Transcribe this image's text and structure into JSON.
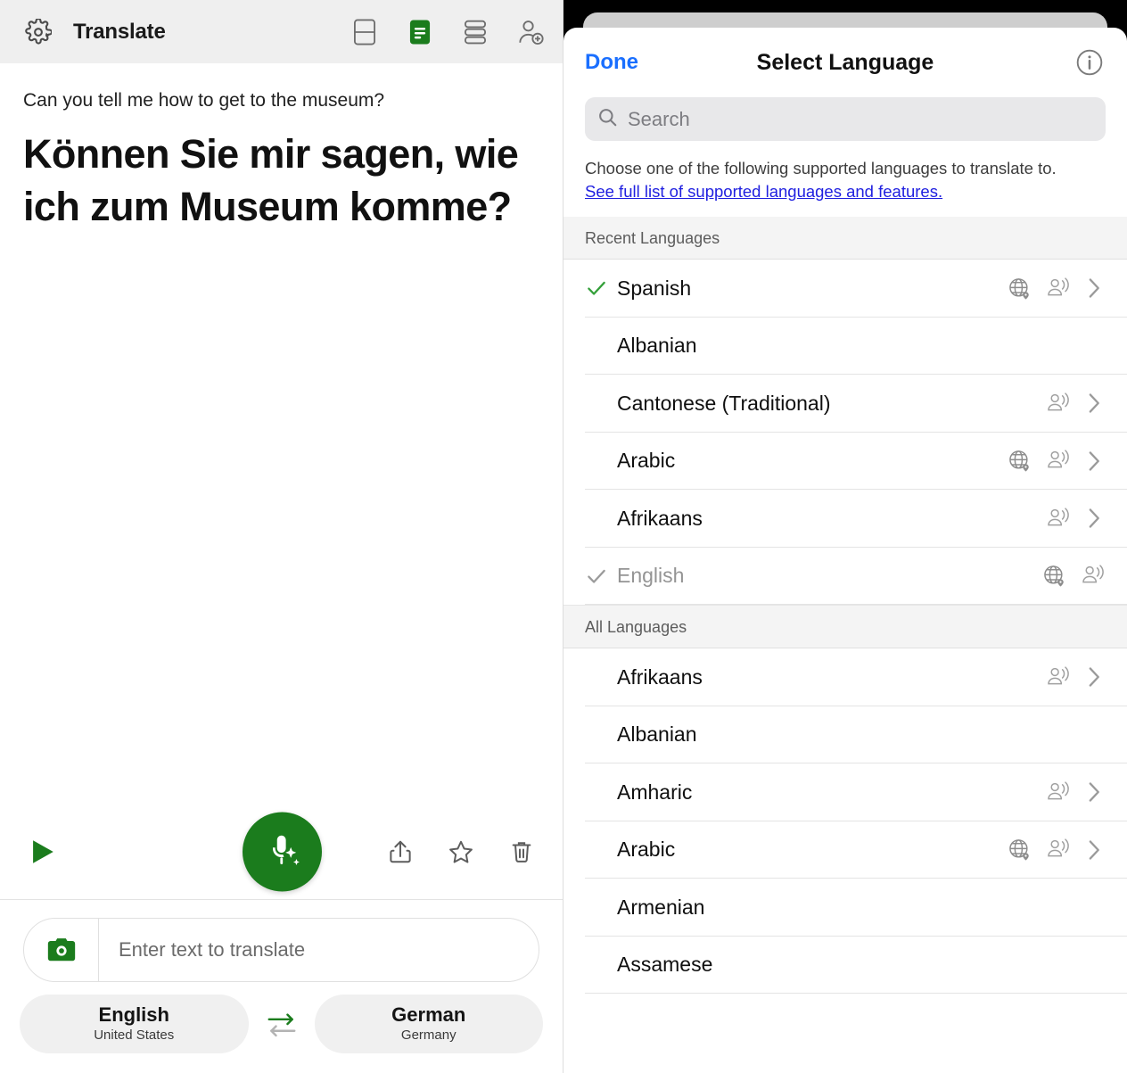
{
  "left": {
    "app_bar": {
      "title": "Translate",
      "gear_icon": "gear-icon",
      "icons": [
        {
          "name": "split-view-icon",
          "active": false
        },
        {
          "name": "document-translate-icon",
          "active": true
        },
        {
          "name": "stacked-list-icon",
          "active": false
        },
        {
          "name": "add-person-icon",
          "active": false
        }
      ]
    },
    "translation": {
      "source_text": "Can you tell me how to get to the museum?",
      "target_text": "Können Sie mir sagen, wie ich zum Museum komme?"
    },
    "actions": {
      "play_icon": "play-icon",
      "mic_icon": "mic-sparkle-icon",
      "share_icon": "share-icon",
      "star_icon": "star-icon",
      "delete_icon": "trash-icon"
    },
    "input": {
      "camera_icon": "camera-icon",
      "placeholder": "Enter text to translate"
    },
    "languages": {
      "source": {
        "name": "English",
        "region": "United States"
      },
      "target": {
        "name": "German",
        "region": "Germany"
      },
      "swap_icon": "swap-arrows-icon"
    }
  },
  "right": {
    "header": {
      "done_label": "Done",
      "title": "Select Language",
      "info_icon": "info-circle-icon"
    },
    "search": {
      "placeholder": "Search",
      "icon": "search-icon"
    },
    "note": {
      "text": "Choose one of the following supported languages to translate to.",
      "link": "See full list of supported languages and features."
    },
    "sections": [
      {
        "header": "Recent Languages",
        "items": [
          {
            "name": "Spanish",
            "checked": true,
            "disabled": false,
            "globe": true,
            "speak": true,
            "chevron": true
          },
          {
            "name": "Albanian",
            "checked": false,
            "disabled": false,
            "globe": false,
            "speak": false,
            "chevron": false
          },
          {
            "name": "Cantonese (Traditional)",
            "checked": false,
            "disabled": false,
            "globe": false,
            "speak": true,
            "chevron": true
          },
          {
            "name": "Arabic",
            "checked": false,
            "disabled": false,
            "globe": true,
            "speak": true,
            "chevron": true
          },
          {
            "name": "Afrikaans",
            "checked": false,
            "disabled": false,
            "globe": false,
            "speak": true,
            "chevron": true
          },
          {
            "name": "English",
            "checked": true,
            "disabled": true,
            "globe": true,
            "speak": true,
            "chevron": false
          }
        ]
      },
      {
        "header": "All Languages",
        "items": [
          {
            "name": "Afrikaans",
            "checked": false,
            "disabled": false,
            "globe": false,
            "speak": true,
            "chevron": true
          },
          {
            "name": "Albanian",
            "checked": false,
            "disabled": false,
            "globe": false,
            "speak": false,
            "chevron": false
          },
          {
            "name": "Amharic",
            "checked": false,
            "disabled": false,
            "globe": false,
            "speak": true,
            "chevron": true
          },
          {
            "name": "Arabic",
            "checked": false,
            "disabled": false,
            "globe": true,
            "speak": true,
            "chevron": true
          },
          {
            "name": "Armenian",
            "checked": false,
            "disabled": false,
            "globe": false,
            "speak": false,
            "chevron": false
          },
          {
            "name": "Assamese",
            "checked": false,
            "disabled": false,
            "globe": false,
            "speak": false,
            "chevron": false
          }
        ]
      }
    ]
  },
  "colors": {
    "brand_green": "#1b7c1d",
    "link_blue": "#2020e0",
    "done_blue": "#1a6fff",
    "check_green": "#34a03a"
  }
}
